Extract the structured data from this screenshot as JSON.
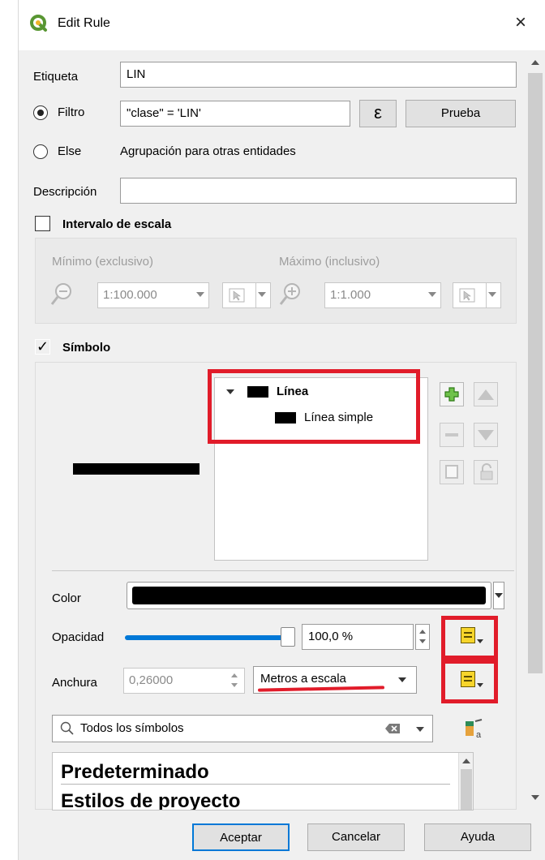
{
  "window": {
    "title": "Edit Rule",
    "close": "×"
  },
  "rule": {
    "label_label": "Etiqueta",
    "label_value": "LIN",
    "filter_label": "Filtro",
    "filter_value": "\"clase\" = 'LIN'",
    "epsilon": "ε",
    "test_button": "Prueba",
    "else_label": "Else",
    "else_desc": "Agrupación para otras entidades",
    "description_label": "Descripción",
    "description_value": ""
  },
  "scale": {
    "title": "Intervalo de escala",
    "min_label": "Mínimo (exclusivo)",
    "max_label": "Máximo (inclusivo)",
    "min_value": "1:100.000",
    "max_value": "1:1.000"
  },
  "symbol": {
    "title": "Símbolo",
    "check": "✓",
    "tree_root": "Línea",
    "tree_child": "Línea simple",
    "color_label": "Color",
    "color_value": "#000000",
    "opacity_label": "Opacidad",
    "opacity_value": "100,0 %",
    "opacity_fraction": 1.0,
    "width_label": "Anchura",
    "width_value": "0,26000",
    "units_value": "Metros a escala"
  },
  "library": {
    "search_placeholder": "Todos los símbolos",
    "items": [
      "Predeterminado",
      "Estilos de proyecto"
    ]
  },
  "footer": {
    "accept": "Aceptar",
    "cancel": "Cancelar",
    "help": "Ayuda"
  },
  "colors": {
    "accent": "#0078d7",
    "highlight_red": "#e11c2a",
    "qgis_green": "#589632"
  }
}
